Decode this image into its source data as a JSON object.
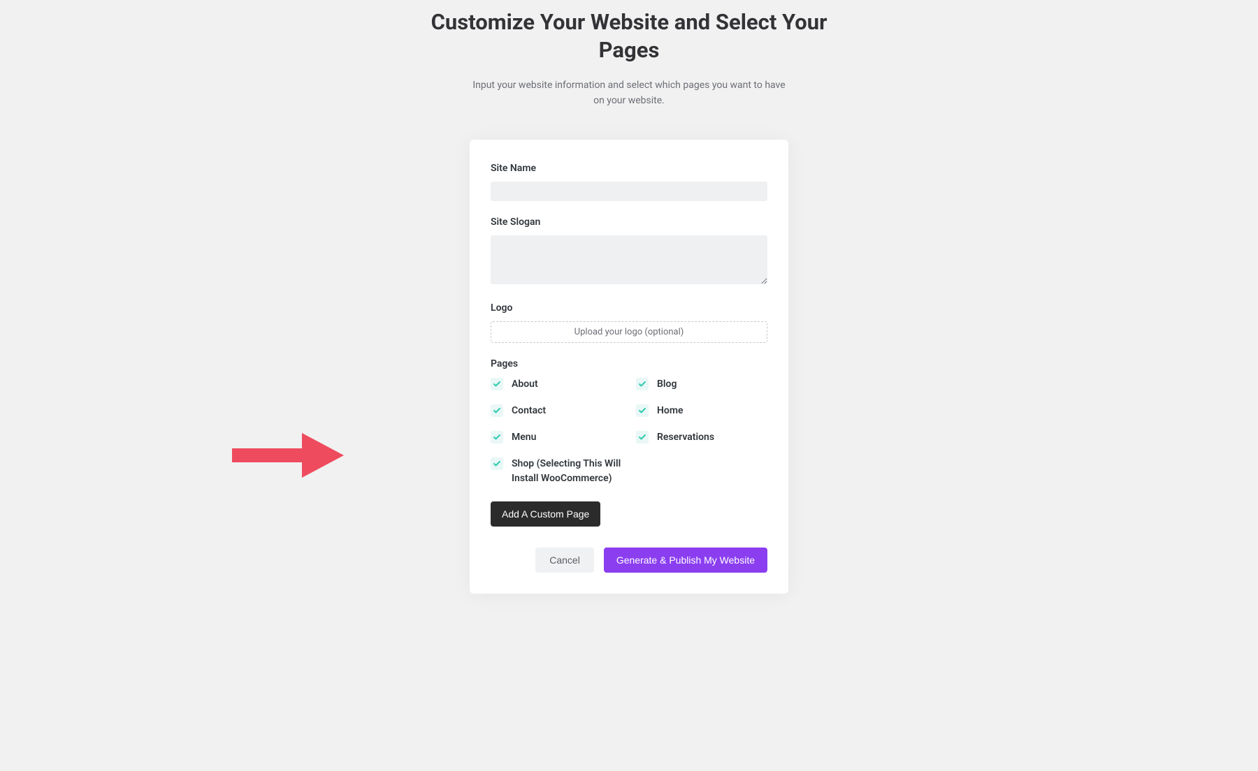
{
  "header": {
    "title": "Customize Your Website and Select Your Pages",
    "subtitle": "Input your website information and select which pages you want to have on your website."
  },
  "form": {
    "siteName": {
      "label": "Site Name",
      "value": ""
    },
    "siteSlogan": {
      "label": "Site Slogan",
      "value": ""
    },
    "logo": {
      "label": "Logo",
      "placeholder": "Upload your logo (optional)"
    },
    "pages": {
      "label": "Pages",
      "items": [
        {
          "label": "About",
          "checked": true
        },
        {
          "label": "Blog",
          "checked": true
        },
        {
          "label": "Contact",
          "checked": true
        },
        {
          "label": "Home",
          "checked": true
        },
        {
          "label": "Menu",
          "checked": true
        },
        {
          "label": "Reservations",
          "checked": true
        },
        {
          "label": "Shop (Selecting This Will Install WooCommerce)",
          "checked": true
        }
      ]
    },
    "addCustomPage": "Add A Custom Page"
  },
  "actions": {
    "cancel": "Cancel",
    "publish": "Generate & Publish My Website"
  },
  "colors": {
    "accent": "#8b3ef0",
    "check": "#2ecbb1",
    "annotation": "#ef4b5e"
  }
}
